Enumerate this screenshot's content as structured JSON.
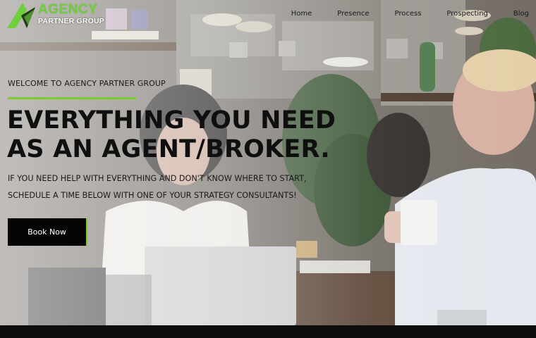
{
  "brand": {
    "name": "AGENCY",
    "tagline": "PARTNER GROUP",
    "accent_color": "#7acb2f"
  },
  "nav": {
    "items": [
      {
        "label": "Home"
      },
      {
        "label": "Presence"
      },
      {
        "label": "Process"
      },
      {
        "label": "Prospecting"
      },
      {
        "label": "Blog"
      }
    ]
  },
  "hero": {
    "eyebrow": "WELCOME TO AGENCY PARTNER GROUP",
    "headline_line1": "EVERYTHING YOU NEED",
    "headline_line2": "AS AN AGENT/BROKER.",
    "subtext_line1": "IF YOU NEED HELP WITH EVERYTHING AND DON'T KNOW WHERE TO START,",
    "subtext_line2": "SCHEDULE A TIME BELOW WITH ONE OF YOUR STRATEGY CONSULTANTS!",
    "cta_label": "Book Now"
  }
}
